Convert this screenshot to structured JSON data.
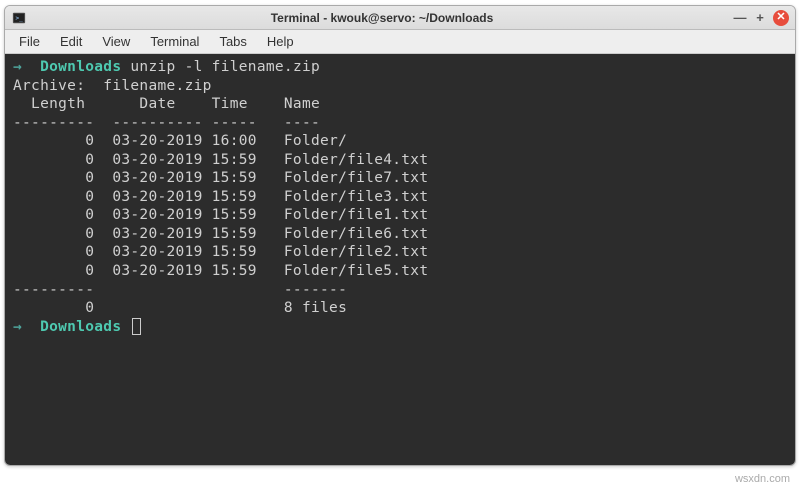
{
  "window": {
    "title": "Terminal - kwouk@servo: ~/Downloads"
  },
  "menu": {
    "file": "File",
    "edit": "Edit",
    "view": "View",
    "terminal": "Terminal",
    "tabs": "Tabs",
    "help": "Help"
  },
  "prompt": {
    "arrow": "→",
    "cwd": "Downloads",
    "command": "unzip -l filename.zip"
  },
  "output": {
    "archive_line": "Archive:  filename.zip",
    "header": "  Length      Date    Time    Name",
    "sep1": "---------  ---------- -----   ----",
    "rows": [
      "        0  03-20-2019 16:00   Folder/",
      "        0  03-20-2019 15:59   Folder/file4.txt",
      "        0  03-20-2019 15:59   Folder/file7.txt",
      "        0  03-20-2019 15:59   Folder/file3.txt",
      "        0  03-20-2019 15:59   Folder/file1.txt",
      "        0  03-20-2019 15:59   Folder/file6.txt",
      "        0  03-20-2019 15:59   Folder/file2.txt",
      "        0  03-20-2019 15:59   Folder/file5.txt"
    ],
    "sep2": "---------                     -------",
    "total": "        0                     8 files"
  },
  "prompt2": {
    "arrow": "→",
    "cwd": "Downloads"
  },
  "watermark": "wsxdn.com"
}
